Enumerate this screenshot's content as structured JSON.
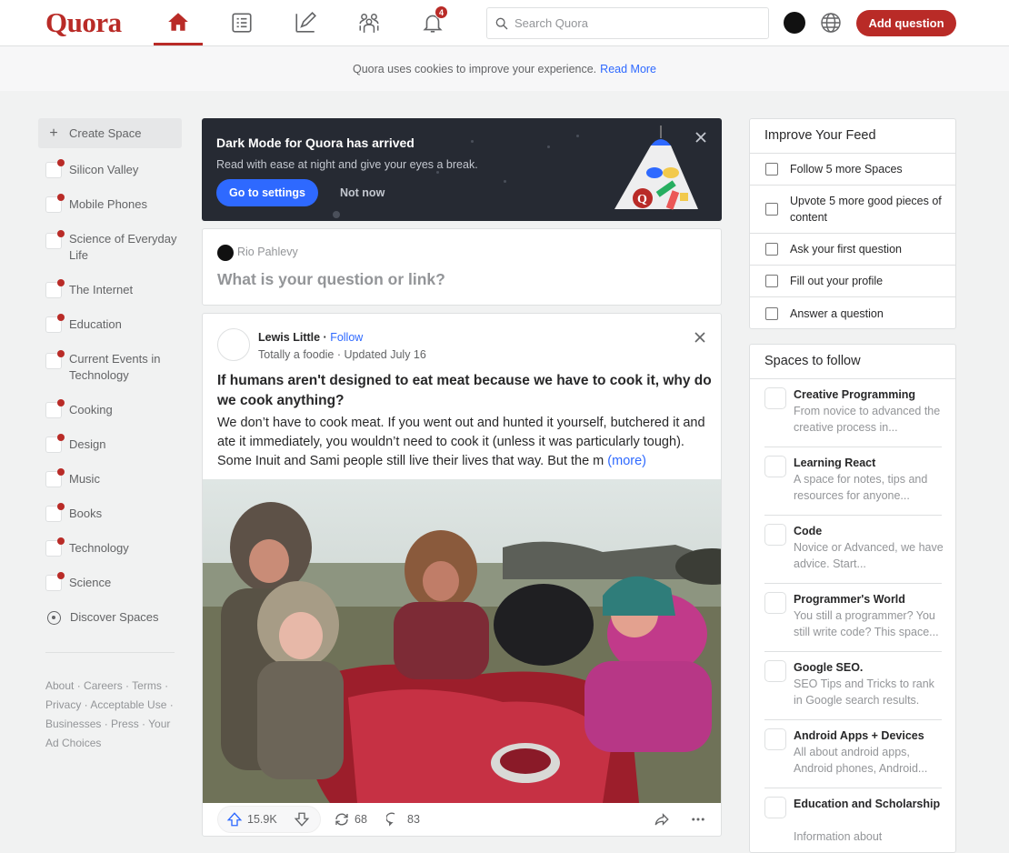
{
  "header": {
    "logo": "Quora",
    "nav": [
      "home-icon",
      "answer-icon",
      "write-icon",
      "spaces-icon",
      "notifications-icon"
    ],
    "notification_count": "4",
    "search_placeholder": "Search Quora",
    "add_question_label": "Add question"
  },
  "cookie_bar": {
    "text": "Quora uses cookies to improve your experience.",
    "link": "Read More"
  },
  "sidebar": {
    "create_label": "Create Space",
    "spaces": [
      "Silicon Valley",
      "Mobile Phones",
      "Science of Everyday Life",
      "The Internet",
      "Education",
      "Current Events in Technology",
      "Cooking",
      "Design",
      "Music",
      "Books",
      "Technology",
      "Science"
    ],
    "discover_label": "Discover Spaces",
    "footer": "About · Careers · Terms · Privacy · Acceptable Use · Businesses · Press · Your Ad Choices"
  },
  "banner": {
    "title": "Dark Mode for Quora has arrived",
    "subtitle": "Read with ease at night and give your eyes a break.",
    "primary_button": "Go to settings",
    "secondary_button": "Not now",
    "accent_color": "#2e69ff"
  },
  "ask": {
    "user": "Rio Pahlevy",
    "prompt": "What is your question or link?"
  },
  "post": {
    "author": "Lewis Little",
    "follow_label": "Follow",
    "credential": "Totally a foodie · Updated July 16",
    "question": "If humans aren't designed to eat meat because we have to cook it, why do we cook anything?",
    "body": "We don’t have to cook meat. If you went out and hunted it yourself, butchered it and ate it immediately, you wouldn’t need to cook it (unless it was particularly tough). Some Inuit and Sami people still live their lives that way. But the m",
    "more_label": "(more)",
    "upvotes": "15.9K",
    "shares": "68",
    "comments": "83"
  },
  "improve_feed": {
    "title": "Improve Your Feed",
    "items": [
      "Follow 5 more Spaces",
      "Upvote 5 more good pieces of content",
      "Ask your first question",
      "Fill out your profile",
      "Answer a question"
    ]
  },
  "spaces_to_follow": {
    "title": "Spaces to follow",
    "items": [
      {
        "name": "Creative Programming",
        "desc": "From novice to advanced the creative process in..."
      },
      {
        "name": "Learning React",
        "desc": "A space for notes, tips and resources for anyone..."
      },
      {
        "name": "Code",
        "desc": "Novice or Advanced, we have advice. Start..."
      },
      {
        "name": "Programmer's World",
        "desc": "You still a programmer? You still write code? This space..."
      },
      {
        "name": "Google SEO.",
        "desc": "SEO Tips and Tricks to rank in Google search results."
      },
      {
        "name": "Android Apps + Devices",
        "desc": "All about android apps, Android phones, Android..."
      },
      {
        "name": "Education and Scholarship",
        "desc": "Information about"
      }
    ]
  },
  "colors": {
    "brand": "#b92b27",
    "link": "#2e69ff",
    "banner_bg": "#262a33"
  }
}
